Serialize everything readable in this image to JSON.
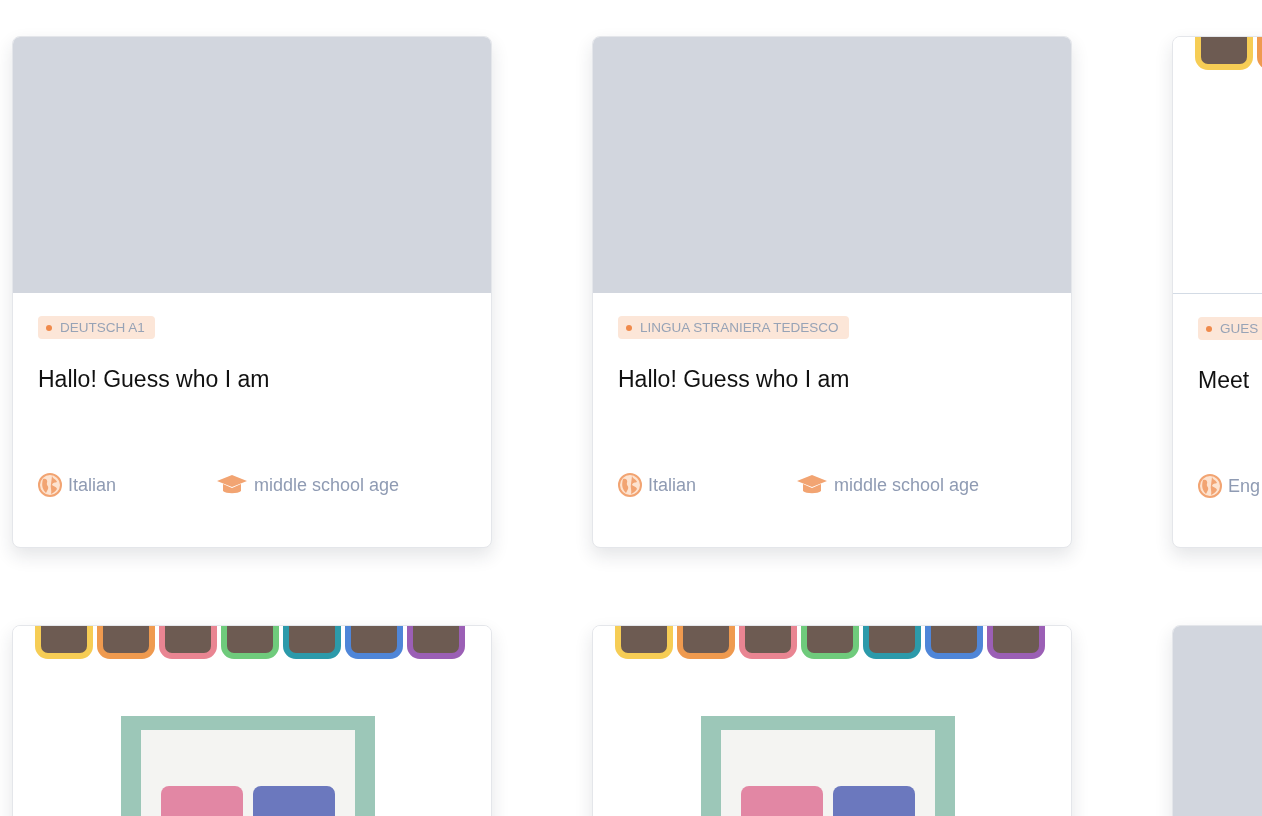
{
  "cards": [
    {
      "thumbnail": {
        "kind": "placeholder"
      },
      "tag": "DEUTSCH A1",
      "title": "Hallo! Guess who I am",
      "language": "Italian",
      "level_group": "middle school age"
    },
    {
      "thumbnail": {
        "kind": "placeholder"
      },
      "tag": "LINGUA STRANIERA TEDESCO",
      "title": "Hallo! Guess who I am",
      "language": "Italian",
      "level_group": "middle school age"
    },
    {
      "thumbnail": {
        "kind": "picture"
      },
      "tag": "GUES",
      "title": "Meet",
      "language": "Eng"
    },
    {
      "thumbnail": {
        "kind": "picture"
      }
    },
    {
      "thumbnail": {
        "kind": "picture"
      }
    },
    {
      "thumbnail": {
        "kind": "placeholder"
      }
    }
  ]
}
